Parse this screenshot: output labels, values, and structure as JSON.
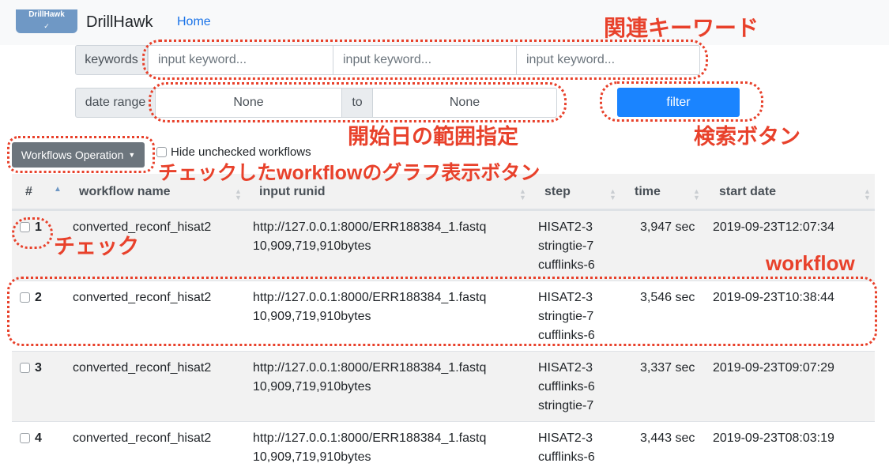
{
  "navbar": {
    "logo_text": "DrillHawk",
    "brand": "DrillHawk",
    "home_link": "Home"
  },
  "filters": {
    "keywords_label": "keywords",
    "keyword_placeholders": [
      "input keyword...",
      "input keyword...",
      "input keyword..."
    ],
    "date_range_label": "date range",
    "date_from": "None",
    "date_to_label": "to",
    "date_to": "None",
    "filter_button": "filter"
  },
  "toolbar": {
    "operations_button": "Workflows Operation",
    "hide_unchecked_label": "Hide unchecked workflows"
  },
  "table": {
    "columns": [
      "#",
      "workflow name",
      "input runid",
      "step",
      "time",
      "start date"
    ],
    "rows": [
      {
        "index": "1",
        "name": "converted_reconf_hisat2",
        "runid": "http://127.0.0.1:8000/ERR188384_1.fastq",
        "size": "10,909,719,910bytes",
        "steps": [
          "HISAT2-3",
          "stringtie-7",
          "cufflinks-6"
        ],
        "time": "3,947 sec",
        "start": "2019-09-23T12:07:34"
      },
      {
        "index": "2",
        "name": "converted_reconf_hisat2",
        "runid": "http://127.0.0.1:8000/ERR188384_1.fastq",
        "size": "10,909,719,910bytes",
        "steps": [
          "HISAT2-3",
          "stringtie-7",
          "cufflinks-6"
        ],
        "time": "3,546 sec",
        "start": "2019-09-23T10:38:44"
      },
      {
        "index": "3",
        "name": "converted_reconf_hisat2",
        "runid": "http://127.0.0.1:8000/ERR188384_1.fastq",
        "size": "10,909,719,910bytes",
        "steps": [
          "HISAT2-3",
          "cufflinks-6",
          "stringtie-7"
        ],
        "time": "3,337 sec",
        "start": "2019-09-23T09:07:29"
      },
      {
        "index": "4",
        "name": "converted_reconf_hisat2",
        "runid": "http://127.0.0.1:8000/ERR188384_1.fastq",
        "size": "10,909,719,910bytes",
        "steps": [
          "HISAT2-3",
          "cufflinks-6",
          ""
        ],
        "time": "3,443 sec",
        "start": "2019-09-23T08:03:19"
      }
    ]
  },
  "annotations": {
    "keywords": "関連キーワード",
    "date_range": "開始日の範囲指定",
    "search_button": "検索ボタン",
    "graph_button": "チェックしたworkflowのグラフ表示ボタン",
    "check": "チェック",
    "workflow": "workflow"
  },
  "colors": {
    "accent_red": "#e8412b",
    "primary_blue": "#1a84ff",
    "secondary_gray": "#6c757d"
  }
}
